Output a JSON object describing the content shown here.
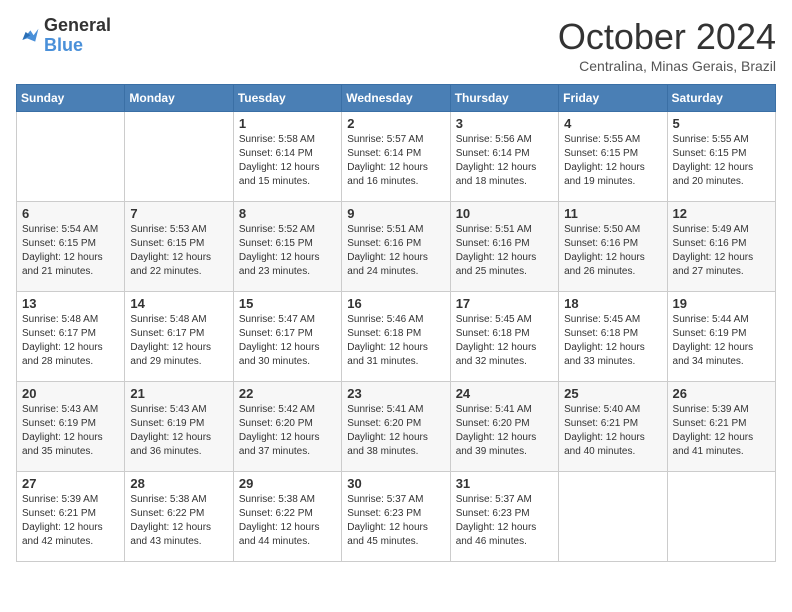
{
  "logo": {
    "general": "General",
    "blue": "Blue"
  },
  "header": {
    "month": "October 2024",
    "location": "Centralina, Minas Gerais, Brazil"
  },
  "weekdays": [
    "Sunday",
    "Monday",
    "Tuesday",
    "Wednesday",
    "Thursday",
    "Friday",
    "Saturday"
  ],
  "weeks": [
    [
      {
        "day": "",
        "sunrise": "",
        "sunset": "",
        "daylight": ""
      },
      {
        "day": "",
        "sunrise": "",
        "sunset": "",
        "daylight": ""
      },
      {
        "day": "1",
        "sunrise": "Sunrise: 5:58 AM",
        "sunset": "Sunset: 6:14 PM",
        "daylight": "Daylight: 12 hours and 15 minutes."
      },
      {
        "day": "2",
        "sunrise": "Sunrise: 5:57 AM",
        "sunset": "Sunset: 6:14 PM",
        "daylight": "Daylight: 12 hours and 16 minutes."
      },
      {
        "day": "3",
        "sunrise": "Sunrise: 5:56 AM",
        "sunset": "Sunset: 6:14 PM",
        "daylight": "Daylight: 12 hours and 18 minutes."
      },
      {
        "day": "4",
        "sunrise": "Sunrise: 5:55 AM",
        "sunset": "Sunset: 6:15 PM",
        "daylight": "Daylight: 12 hours and 19 minutes."
      },
      {
        "day": "5",
        "sunrise": "Sunrise: 5:55 AM",
        "sunset": "Sunset: 6:15 PM",
        "daylight": "Daylight: 12 hours and 20 minutes."
      }
    ],
    [
      {
        "day": "6",
        "sunrise": "Sunrise: 5:54 AM",
        "sunset": "Sunset: 6:15 PM",
        "daylight": "Daylight: 12 hours and 21 minutes."
      },
      {
        "day": "7",
        "sunrise": "Sunrise: 5:53 AM",
        "sunset": "Sunset: 6:15 PM",
        "daylight": "Daylight: 12 hours and 22 minutes."
      },
      {
        "day": "8",
        "sunrise": "Sunrise: 5:52 AM",
        "sunset": "Sunset: 6:15 PM",
        "daylight": "Daylight: 12 hours and 23 minutes."
      },
      {
        "day": "9",
        "sunrise": "Sunrise: 5:51 AM",
        "sunset": "Sunset: 6:16 PM",
        "daylight": "Daylight: 12 hours and 24 minutes."
      },
      {
        "day": "10",
        "sunrise": "Sunrise: 5:51 AM",
        "sunset": "Sunset: 6:16 PM",
        "daylight": "Daylight: 12 hours and 25 minutes."
      },
      {
        "day": "11",
        "sunrise": "Sunrise: 5:50 AM",
        "sunset": "Sunset: 6:16 PM",
        "daylight": "Daylight: 12 hours and 26 minutes."
      },
      {
        "day": "12",
        "sunrise": "Sunrise: 5:49 AM",
        "sunset": "Sunset: 6:16 PM",
        "daylight": "Daylight: 12 hours and 27 minutes."
      }
    ],
    [
      {
        "day": "13",
        "sunrise": "Sunrise: 5:48 AM",
        "sunset": "Sunset: 6:17 PM",
        "daylight": "Daylight: 12 hours and 28 minutes."
      },
      {
        "day": "14",
        "sunrise": "Sunrise: 5:48 AM",
        "sunset": "Sunset: 6:17 PM",
        "daylight": "Daylight: 12 hours and 29 minutes."
      },
      {
        "day": "15",
        "sunrise": "Sunrise: 5:47 AM",
        "sunset": "Sunset: 6:17 PM",
        "daylight": "Daylight: 12 hours and 30 minutes."
      },
      {
        "day": "16",
        "sunrise": "Sunrise: 5:46 AM",
        "sunset": "Sunset: 6:18 PM",
        "daylight": "Daylight: 12 hours and 31 minutes."
      },
      {
        "day": "17",
        "sunrise": "Sunrise: 5:45 AM",
        "sunset": "Sunset: 6:18 PM",
        "daylight": "Daylight: 12 hours and 32 minutes."
      },
      {
        "day": "18",
        "sunrise": "Sunrise: 5:45 AM",
        "sunset": "Sunset: 6:18 PM",
        "daylight": "Daylight: 12 hours and 33 minutes."
      },
      {
        "day": "19",
        "sunrise": "Sunrise: 5:44 AM",
        "sunset": "Sunset: 6:19 PM",
        "daylight": "Daylight: 12 hours and 34 minutes."
      }
    ],
    [
      {
        "day": "20",
        "sunrise": "Sunrise: 5:43 AM",
        "sunset": "Sunset: 6:19 PM",
        "daylight": "Daylight: 12 hours and 35 minutes."
      },
      {
        "day": "21",
        "sunrise": "Sunrise: 5:43 AM",
        "sunset": "Sunset: 6:19 PM",
        "daylight": "Daylight: 12 hours and 36 minutes."
      },
      {
        "day": "22",
        "sunrise": "Sunrise: 5:42 AM",
        "sunset": "Sunset: 6:20 PM",
        "daylight": "Daylight: 12 hours and 37 minutes."
      },
      {
        "day": "23",
        "sunrise": "Sunrise: 5:41 AM",
        "sunset": "Sunset: 6:20 PM",
        "daylight": "Daylight: 12 hours and 38 minutes."
      },
      {
        "day": "24",
        "sunrise": "Sunrise: 5:41 AM",
        "sunset": "Sunset: 6:20 PM",
        "daylight": "Daylight: 12 hours and 39 minutes."
      },
      {
        "day": "25",
        "sunrise": "Sunrise: 5:40 AM",
        "sunset": "Sunset: 6:21 PM",
        "daylight": "Daylight: 12 hours and 40 minutes."
      },
      {
        "day": "26",
        "sunrise": "Sunrise: 5:39 AM",
        "sunset": "Sunset: 6:21 PM",
        "daylight": "Daylight: 12 hours and 41 minutes."
      }
    ],
    [
      {
        "day": "27",
        "sunrise": "Sunrise: 5:39 AM",
        "sunset": "Sunset: 6:21 PM",
        "daylight": "Daylight: 12 hours and 42 minutes."
      },
      {
        "day": "28",
        "sunrise": "Sunrise: 5:38 AM",
        "sunset": "Sunset: 6:22 PM",
        "daylight": "Daylight: 12 hours and 43 minutes."
      },
      {
        "day": "29",
        "sunrise": "Sunrise: 5:38 AM",
        "sunset": "Sunset: 6:22 PM",
        "daylight": "Daylight: 12 hours and 44 minutes."
      },
      {
        "day": "30",
        "sunrise": "Sunrise: 5:37 AM",
        "sunset": "Sunset: 6:23 PM",
        "daylight": "Daylight: 12 hours and 45 minutes."
      },
      {
        "day": "31",
        "sunrise": "Sunrise: 5:37 AM",
        "sunset": "Sunset: 6:23 PM",
        "daylight": "Daylight: 12 hours and 46 minutes."
      },
      {
        "day": "",
        "sunrise": "",
        "sunset": "",
        "daylight": ""
      },
      {
        "day": "",
        "sunrise": "",
        "sunset": "",
        "daylight": ""
      }
    ]
  ]
}
